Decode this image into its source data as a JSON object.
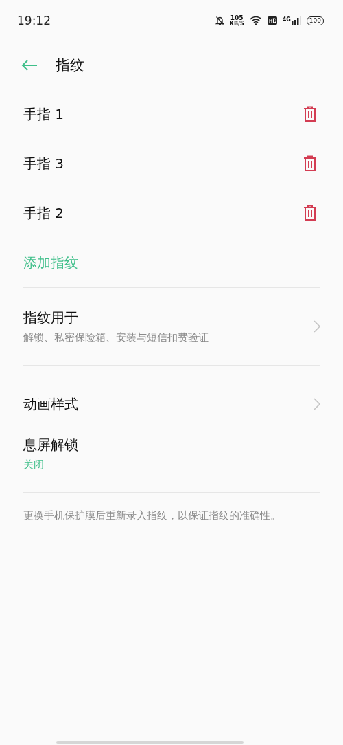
{
  "status_bar": {
    "time": "19:12",
    "net_speed": "105",
    "net_unit": "KB/S",
    "network": "4G",
    "battery": "100"
  },
  "header": {
    "title": "指纹"
  },
  "fingerprints": [
    {
      "name": "手指 1"
    },
    {
      "name": "手指 3"
    },
    {
      "name": "手指 2"
    }
  ],
  "add_button": "添加指纹",
  "sections": [
    [
      {
        "kind": "link",
        "title": "指纹用于",
        "subtitle": "解锁、私密保险箱、安装与短信扣费验证"
      }
    ],
    [
      {
        "kind": "link",
        "title": "动画样式"
      },
      {
        "kind": "plain",
        "title": "息屏解锁",
        "value": "关闭"
      }
    ]
  ],
  "note": "更换手机保护膜后重新录入指纹，以保证指纹的准确性。"
}
